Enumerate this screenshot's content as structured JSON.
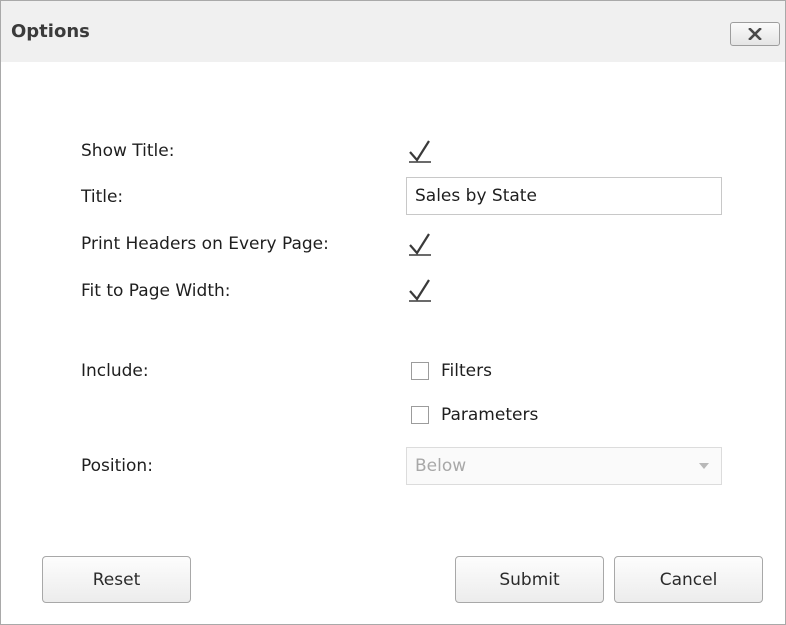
{
  "dialog": {
    "title": "Options",
    "close_icon": "close-icon"
  },
  "form": {
    "show_title_label": "Show Title:",
    "show_title_checked": true,
    "title_label": "Title:",
    "title_value": "Sales by State",
    "print_headers_label": "Print Headers on Every Page:",
    "print_headers_checked": true,
    "fit_width_label": "Fit to Page Width:",
    "fit_width_checked": true,
    "include_label": "Include:",
    "include_filters_label": "Filters",
    "include_filters_checked": false,
    "include_parameters_label": "Parameters",
    "include_parameters_checked": false,
    "position_label": "Position:",
    "position_value": "Below",
    "position_enabled": false
  },
  "buttons": {
    "reset": "Reset",
    "submit": "Submit",
    "cancel": "Cancel"
  }
}
